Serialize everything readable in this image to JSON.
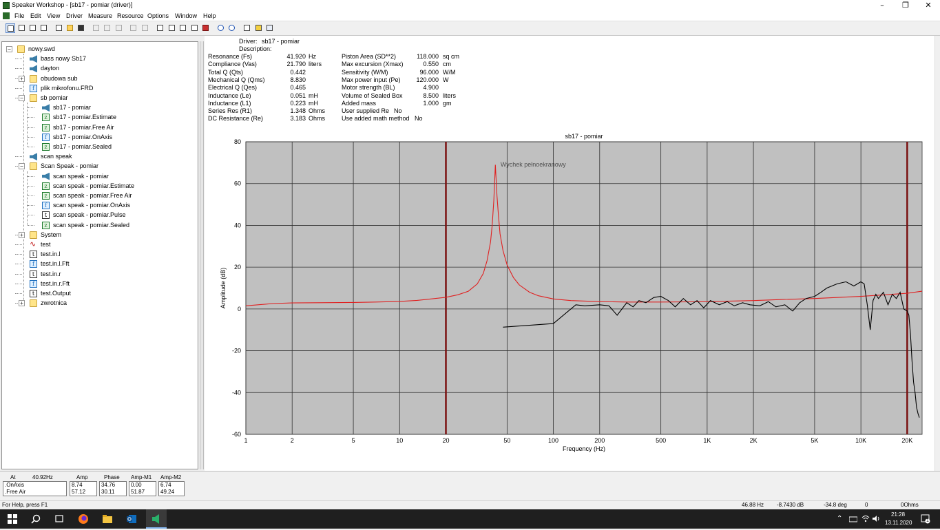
{
  "window": {
    "title": "Speaker Workshop - [sb17 - pomiar (driver)]",
    "controls": [
      "–",
      "❐",
      "✕"
    ],
    "brand_color": "#2a6b2a"
  },
  "menu": [
    "File",
    "Edit",
    "View",
    "Driver",
    "Measure",
    "Resource",
    "Options",
    "Window",
    "Help"
  ],
  "toolbar": {
    "icons": [
      "tree-view-icon",
      "list-view-icon",
      "detail-view-icon",
      "grid-view-icon",
      "new-file-icon",
      "open-folder-icon",
      "save-icon",
      "cut-icon",
      "copy-icon",
      "paste-icon",
      "undo-icon",
      "redo-icon",
      "open-icon",
      "window-icon",
      "chart-icon",
      "print-preview-icon",
      "record-icon",
      "zoom-in-icon",
      "zoom-out-icon",
      "print-icon",
      "settings-icon",
      "help-icon",
      "context-help-icon"
    ]
  },
  "tree": {
    "items": [
      {
        "label": "nowy.swd",
        "icon": "folder",
        "depth": 0,
        "expander": "−"
      },
      {
        "label": "bass nowy Sb17",
        "icon": "speaker",
        "depth": 1
      },
      {
        "label": "dayton",
        "icon": "speaker",
        "depth": 1
      },
      {
        "label": "obudowa sub",
        "icon": "folder",
        "depth": 1,
        "expander": "+"
      },
      {
        "label": "plik mikrofonu.FRD",
        "icon": "f-doc",
        "depth": 1
      },
      {
        "label": "sb pomiar",
        "icon": "folder",
        "depth": 1,
        "expander": "−"
      },
      {
        "label": "sb17 - pomiar",
        "icon": "speaker",
        "depth": 2
      },
      {
        "label": "sb17 - pomiar.Estimate",
        "icon": "z-doc",
        "depth": 2
      },
      {
        "label": "sb17 - pomiar.Free Air",
        "icon": "z-doc",
        "depth": 2
      },
      {
        "label": "sb17 - pomiar.OnAxis",
        "icon": "f-doc",
        "depth": 2
      },
      {
        "label": "sb17 - pomiar.Sealed",
        "icon": "z-doc",
        "depth": 2
      },
      {
        "label": "scan speak",
        "icon": "speaker",
        "depth": 1
      },
      {
        "label": "Scan Speak - pomiar",
        "icon": "folder",
        "depth": 1,
        "expander": "−"
      },
      {
        "label": "scan speak - pomiar",
        "icon": "speaker",
        "depth": 2
      },
      {
        "label": "scan speak - pomiar.Estimate",
        "icon": "z-doc",
        "depth": 2
      },
      {
        "label": "scan speak - pomiar.Free Air",
        "icon": "z-doc",
        "depth": 2
      },
      {
        "label": "scan speak - pomiar.OnAxis",
        "icon": "f-doc",
        "depth": 2
      },
      {
        "label": "scan speak - pomiar.Pulse",
        "icon": "t-doc",
        "depth": 2
      },
      {
        "label": "scan speak - pomiar.Sealed",
        "icon": "z-doc",
        "depth": 2
      },
      {
        "label": "System",
        "icon": "folder",
        "depth": 1,
        "expander": "+"
      },
      {
        "label": "test",
        "icon": "wave",
        "depth": 1
      },
      {
        "label": "test.in.l",
        "icon": "t-doc",
        "depth": 1
      },
      {
        "label": "test.in.l.Fft",
        "icon": "f-doc",
        "depth": 1
      },
      {
        "label": "test.in.r",
        "icon": "t-doc",
        "depth": 1
      },
      {
        "label": "test.in.r.Fft",
        "icon": "f-doc",
        "depth": 1
      },
      {
        "label": "test.Output",
        "icon": "t-doc",
        "depth": 1
      },
      {
        "label": "zwrotnica",
        "icon": "folder",
        "depth": 1,
        "expander": "+"
      }
    ]
  },
  "driver": {
    "driver_label": "Driver:",
    "driver_name": "sb17 - pomiar",
    "description_label": "Description:",
    "left_params": [
      {
        "label": "Resonance (Fs)",
        "value": "41.920",
        "unit": "Hz"
      },
      {
        "label": "Compliance (Vas)",
        "value": "21.790",
        "unit": "liters"
      },
      {
        "label": "Total Q (Qts)",
        "value": "0.442",
        "unit": ""
      },
      {
        "label": "Mechanical Q (Qms)",
        "value": "8.830",
        "unit": ""
      },
      {
        "label": "Electrical Q (Qes)",
        "value": "0.465",
        "unit": ""
      },
      {
        "label": "Inductance (Le)",
        "value": "0.051",
        "unit": "mH"
      },
      {
        "label": "Inductance (L1)",
        "value": "0.223",
        "unit": "mH"
      },
      {
        "label": "Series Res (R1)",
        "value": "1.348",
        "unit": "Ohms"
      },
      {
        "label": "DC Resistance (Re)",
        "value": "3.183",
        "unit": "Ohms"
      }
    ],
    "right_params": [
      {
        "label": "Piston Area (SD**2)",
        "value": "118.000",
        "unit": "sq cm"
      },
      {
        "label": "Max excursion (Xmax)",
        "value": "0.550",
        "unit": "cm"
      },
      {
        "label": "Sensitivity (W/M)",
        "value": "96.000",
        "unit": "W/M"
      },
      {
        "label": "Max power input (Pe)",
        "value": "120.000",
        "unit": "W"
      },
      {
        "label": "Motor strength (BL)",
        "value": "4.900",
        "unit": ""
      },
      {
        "label": "Volume of Sealed Box",
        "value": "8.500",
        "unit": "liters"
      },
      {
        "label": "Added mass",
        "value": "1.000",
        "unit": "gm"
      },
      {
        "label": "User supplied Re",
        "value": "No",
        "unit": ""
      },
      {
        "label": "Use added math method",
        "value": "No",
        "unit": ""
      }
    ]
  },
  "chart_data": {
    "type": "line",
    "title": "sb17 - pomiar",
    "xlabel": "Frequency (Hz)",
    "ylabel": "Amplitude (dB)",
    "xscale": "log",
    "xlim": [
      1,
      25000
    ],
    "ylim": [
      -60,
      80
    ],
    "xticks": [
      1,
      2,
      5,
      10,
      20,
      50,
      100,
      200,
      500,
      1000,
      2000,
      5000,
      10000,
      20000
    ],
    "xtick_labels": [
      "1",
      "2",
      "5",
      "10",
      "20",
      "50",
      "100",
      "200",
      "500",
      "1K",
      "2K",
      "5K",
      "10K",
      "20K"
    ],
    "yticks": [
      -60,
      -40,
      -20,
      0,
      20,
      40,
      60,
      80
    ],
    "grid": true,
    "background": "#c0c0c0",
    "markers": [
      20,
      20000
    ],
    "marker_color": "#7a1010",
    "watermark": "Wychek pełnoekranowy",
    "series": [
      {
        "color": "#e02020",
        "x": [
          1,
          1.5,
          2,
          3,
          5,
          7,
          10,
          13,
          16,
          20,
          24,
          28,
          32,
          35,
          37,
          39,
          40,
          41,
          41.92,
          43,
          44,
          45,
          47,
          50,
          55,
          60,
          70,
          80,
          100,
          130,
          200,
          300,
          500,
          800,
          1000,
          2000,
          3000,
          5000,
          10000,
          20000,
          25000
        ],
        "y": [
          1.5,
          2.6,
          2.9,
          3.0,
          3.1,
          3.3,
          3.6,
          4.1,
          4.8,
          5.6,
          6.8,
          8.5,
          12,
          17,
          23,
          32,
          40,
          52,
          69,
          54,
          44,
          36,
          28,
          21,
          15,
          11.5,
          8,
          6.3,
          4.8,
          4,
          3.5,
          3.3,
          3.3,
          3.4,
          3.5,
          4,
          4.5,
          5,
          6,
          7.5,
          8.5
        ]
      },
      {
        "color": "#000000",
        "x": [
          47,
          100,
          140,
          160,
          200,
          230,
          260,
          300,
          330,
          360,
          400,
          450,
          500,
          560,
          620,
          700,
          780,
          860,
          950,
          1050,
          1200,
          1350,
          1500,
          1700,
          1900,
          2200,
          2500,
          2800,
          3200,
          3600,
          4000,
          4400,
          5000,
          5500,
          6000,
          7000,
          8000,
          9000,
          10000,
          10500,
          11000,
          11500,
          12000,
          12500,
          13000,
          14000,
          15000,
          16000,
          17000,
          18000,
          19000,
          20000,
          20500,
          21000,
          21500,
          22000,
          22500,
          23000,
          23500,
          24000
        ],
        "y": [
          -8.7,
          -7,
          2,
          1.5,
          2,
          1.5,
          -3,
          3,
          1,
          4,
          3,
          5.5,
          6,
          4,
          1,
          5,
          2,
          4,
          0.5,
          4,
          2,
          3.5,
          1.5,
          3,
          2,
          1.5,
          3.5,
          1,
          2,
          -1,
          3,
          5,
          6,
          8,
          10,
          12,
          13,
          11,
          13,
          12,
          2,
          -10,
          4,
          7,
          5,
          8,
          2,
          7,
          5,
          8,
          0,
          -1,
          -3,
          -12,
          -25,
          -35,
          -40,
          -47,
          -50,
          -52
        ]
      }
    ]
  },
  "bottom": {
    "at_label": "At",
    "at_value": "40.92Hz",
    "rows": [
      ".OnAxis",
      ".Free Air"
    ],
    "columns": [
      {
        "header": "Amp",
        "values": [
          "8.74",
          "57.12"
        ]
      },
      {
        "header": "Phase",
        "values": [
          "34.76",
          "30.11"
        ]
      },
      {
        "header": "Amp-M1",
        "values": [
          "0.00",
          "51.87"
        ]
      },
      {
        "header": "Amp-M2",
        "values": [
          "6.74",
          "49.24"
        ]
      }
    ]
  },
  "status": {
    "help": "For Help, press F1",
    "freq": "46.88 Hz",
    "db": "-8.7430 dB",
    "deg": "-34.8 deg",
    "zero": "0",
    "ohms": "0Ohms"
  },
  "taskbar": {
    "time": "21:28",
    "date": "13.11.2020",
    "notifications": "1",
    "accent": "#7fb0e8"
  }
}
